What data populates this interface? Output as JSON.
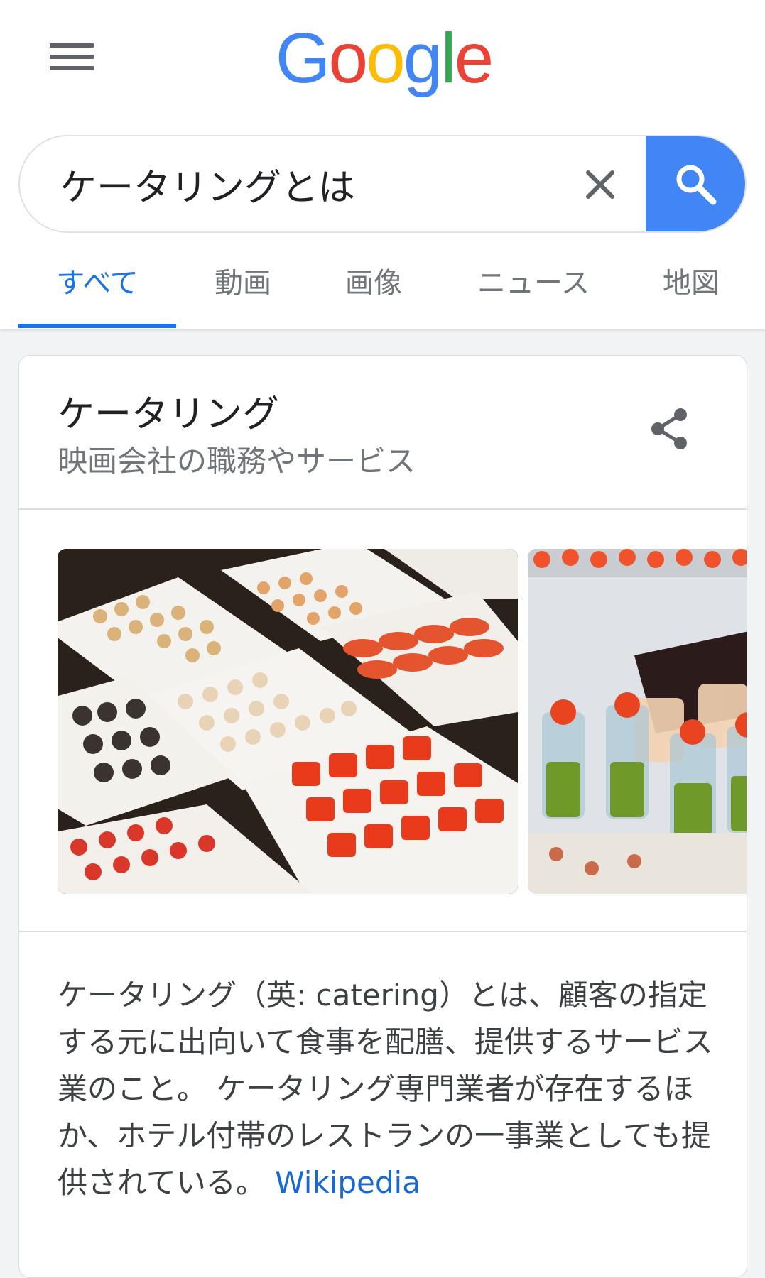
{
  "header": {
    "logo_text": "Google",
    "icons": {
      "menu": "hamburger-menu-icon"
    }
  },
  "search": {
    "query": "ケータリングとは",
    "clear_icon": "close-icon",
    "search_icon": "search-icon",
    "accent_color": "#4285f4"
  },
  "tabs": [
    {
      "label": "すべて",
      "active": true
    },
    {
      "label": "動画"
    },
    {
      "label": "画像"
    },
    {
      "label": "ニュース"
    },
    {
      "label": "地図"
    }
  ],
  "knowledge_panel": {
    "title": "ケータリング",
    "subtitle": "映画会社の職務やサービス",
    "share_icon": "share-icon",
    "images": [
      {
        "name": "catering-sushi-platters"
      },
      {
        "name": "catering-appetizer-cups"
      }
    ],
    "description": "ケータリング（英: catering）とは、顧客の指定する元に出向いて食事を配膳、提供するサービス業のこと。 ケータリング専門業者が存在するほか、ホテル付帯のレストランの一事業としても提供されている。 ",
    "source_link": "Wikipedia"
  }
}
